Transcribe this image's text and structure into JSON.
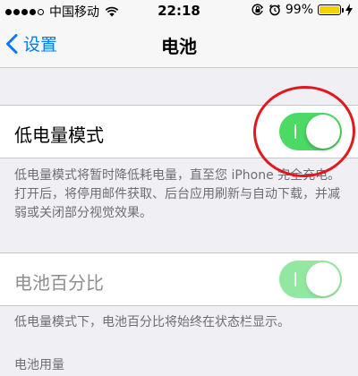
{
  "status_bar": {
    "carrier": "中国移动",
    "time": "22:18",
    "battery_percent": "99%",
    "signal_bars": 4,
    "battery_level": 0.99,
    "icons": [
      "wifi-icon",
      "orientation-lock-icon",
      "alarm-icon",
      "charging-bolt-icon"
    ]
  },
  "nav": {
    "back_label": "设置",
    "title": "电池"
  },
  "low_power": {
    "label": "低电量模式",
    "enabled": true,
    "description": "低电量模式将暂时降低耗电量，直至您 iPhone 完全充电。打开后，将停用邮件获取、后台应用刷新与自动下载，并减弱或关闭部分视觉效果。"
  },
  "battery_percentage": {
    "label": "电池百分比",
    "enabled": true,
    "disabled": true,
    "description": "低电量模式下，电池百分比将始终在状态栏显示。"
  },
  "usage_section": {
    "header": "电池用量"
  },
  "colors": {
    "accent": "#007aff",
    "switch_on": "#4cd964",
    "battery_fill": "#f5d100",
    "annotation": "#e0191e"
  }
}
